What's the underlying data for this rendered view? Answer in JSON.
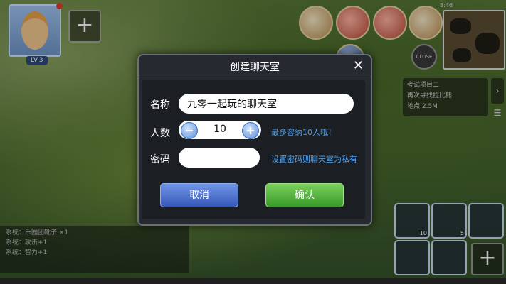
{
  "hud": {
    "level_badge": "LV.3",
    "status_time": "8:46",
    "close_label": "CLOSE",
    "quest": {
      "title": "考试项目二",
      "line1": "再次寻找拉比熊",
      "line2": "地点 2.5M"
    },
    "chat_log": [
      "系统：乐园团靴子 ×1",
      "系统：攻击+1",
      "系统：智力+1"
    ],
    "slot_counts": [
      "10",
      "5"
    ]
  },
  "dialog": {
    "title": "创建聊天室",
    "close_symbol": "✕",
    "name_label": "名称",
    "name_value": "九零一起玩的聊天室",
    "count_label": "人数",
    "count_value": "10",
    "count_hint": "最多容纳10人哦！",
    "decrement_symbol": "−",
    "increment_symbol": "+",
    "password_label": "密码",
    "password_value": "",
    "password_hint": "设置密码则聊天室为私有",
    "cancel_label": "取消",
    "confirm_label": "确认"
  }
}
